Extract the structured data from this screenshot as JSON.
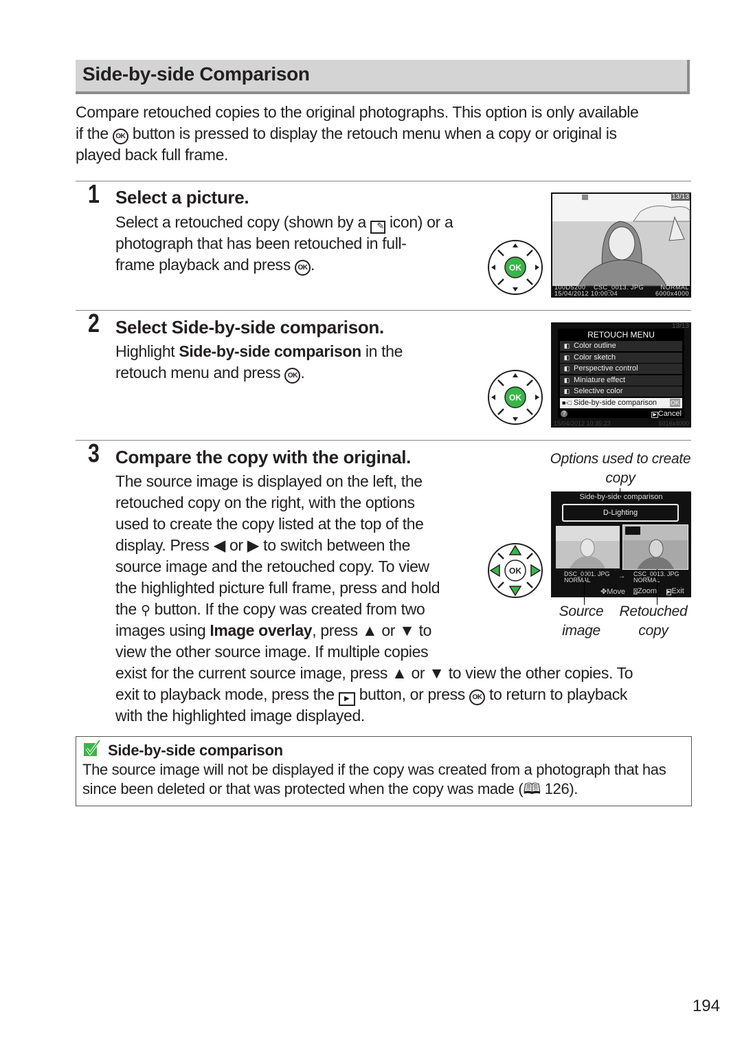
{
  "title": "Side-by-side Comparison",
  "intro": [
    [
      {
        "t": "Compare retouched copies to the original photographs.  This option is only available"
      }
    ],
    [
      {
        "t": "if the "
      },
      {
        "icon": "ok"
      },
      {
        "t": " button is pressed to display the retouch menu when a copy or original is"
      }
    ],
    [
      {
        "t": "played back full frame."
      }
    ]
  ],
  "steps": [
    {
      "number": "1",
      "title": "Select a picture.",
      "lines": [
        [
          {
            "t": "Select a retouched copy (shown by a "
          },
          {
            "icon": "retouch"
          },
          {
            "t": " icon) or a"
          }
        ],
        [
          {
            "t": "photograph that has been retouched in full-"
          }
        ],
        [
          {
            "t": "frame playback and press "
          },
          {
            "icon": "ok"
          },
          {
            "t": "."
          }
        ]
      ]
    },
    {
      "number": "2",
      "title_prefix": "Select ",
      "title_bold": "Side-by-side comparison",
      "title_suffix": ".",
      "lines": [
        [
          {
            "t": "Highlight "
          },
          {
            "t": "Side-by-side comparison",
            "b": true
          },
          {
            "t": " in the"
          }
        ],
        [
          {
            "t": "retouch menu and press "
          },
          {
            "icon": "ok"
          },
          {
            "t": "."
          }
        ]
      ]
    },
    {
      "number": "3",
      "title": "Compare the copy with the original.",
      "lines": [
        [
          {
            "t": "The source image is displayed on the left, the"
          }
        ],
        [
          {
            "t": "retouched copy on the right, with the options"
          }
        ],
        [
          {
            "t": "used to create the copy listed at the top of the"
          }
        ],
        [
          {
            "t": "display.  Press "
          },
          {
            "icon": "left"
          },
          {
            "t": " or "
          },
          {
            "icon": "right"
          },
          {
            "t": " to switch between the"
          }
        ],
        [
          {
            "t": "source image and the retouched copy.  To view"
          }
        ],
        [
          {
            "t": "the highlighted picture full frame, press and hold"
          }
        ],
        [
          {
            "t": "the "
          },
          {
            "icon": "zoom"
          },
          {
            "t": " button.  If the copy was created from two"
          }
        ],
        [
          {
            "t": "images using "
          },
          {
            "t": "Image overlay",
            "b": true
          },
          {
            "t": ", press "
          },
          {
            "icon": "up"
          },
          {
            "t": " or "
          },
          {
            "icon": "down"
          },
          {
            "t": " to"
          }
        ],
        [
          {
            "t": "view the other source image.  If multiple copies"
          }
        ],
        [
          {
            "t": "exist for the current source image, press "
          },
          {
            "icon": "up"
          },
          {
            "t": " or "
          },
          {
            "icon": "down"
          },
          {
            "t": " to view the other copies.  To"
          }
        ],
        [
          {
            "t": "exit to playback mode, press the "
          },
          {
            "icon": "play"
          },
          {
            "t": " button, or press "
          },
          {
            "icon": "ok"
          },
          {
            "t": " to return to playback"
          }
        ],
        [
          {
            "t": "with the highlighted image displayed."
          }
        ]
      ],
      "captions": {
        "options": "Options used to create copy",
        "source": "Source image",
        "retouched": "Retouched copy"
      }
    }
  ],
  "screen1": {
    "counter": "13/13",
    "folder": "100D5200",
    "file": "CSC_0013. JPG",
    "quality": "NORMAL",
    "date": "15/04/2012  10:00:04",
    "size": "6000x4000"
  },
  "screen2": {
    "header": "RETOUCH MENU",
    "counter": "13/13",
    "items": [
      {
        "icon": "color-outline",
        "label": "Color outline"
      },
      {
        "icon": "color-sketch",
        "label": "Color sketch"
      },
      {
        "icon": "perspective",
        "label": "Perspective control"
      },
      {
        "icon": "miniature",
        "label": "Miniature effect"
      },
      {
        "icon": "selective-color",
        "label": "Selective color"
      },
      {
        "icon": "side-by-side",
        "label": "Side-by-side comparison",
        "selected": true,
        "badge": "OK"
      }
    ],
    "help": "?",
    "cancel": "Cancel",
    "footer": "15/04/2012  10:35:23",
    "footer_size": "5016x4000"
  },
  "screen3": {
    "header": "Side-by-side comparison",
    "option": "D-Lighting",
    "left_file": "DSC_0001. JPG",
    "left_quality": "NORMAL",
    "right_file": "CSC_0013. JPG",
    "right_quality": "NORMAL",
    "move": "Move",
    "zoom": "Zoom",
    "exit": "Exit"
  },
  "dpad_center": "OK",
  "note": {
    "title": "Side-by-side comparison",
    "lines": [
      [
        {
          "t": "The source image will not be displayed if the copy was created from a photograph that has"
        }
      ],
      [
        {
          "t": "since been deleted or that was protected when the copy was made ("
        },
        {
          "icon": "book"
        },
        {
          "t": " 126)."
        }
      ]
    ]
  },
  "page_number": "194",
  "colors": {
    "accent_green": "#3ab54a",
    "title_bar": "#d4d4d4"
  }
}
